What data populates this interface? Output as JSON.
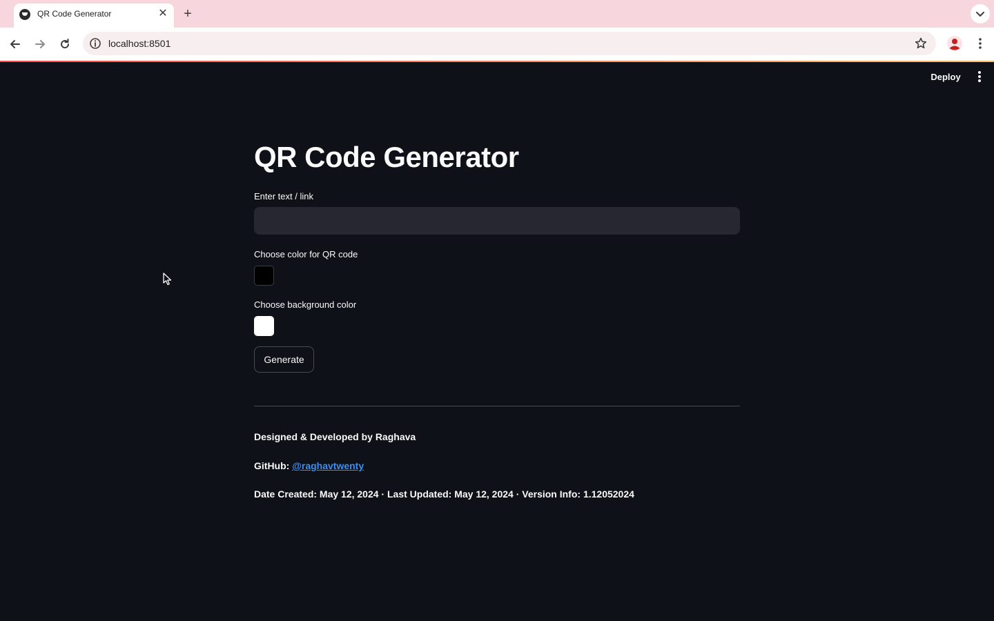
{
  "browser": {
    "tab_title": "QR Code Generator",
    "url": "localhost:8501"
  },
  "header": {
    "deploy_label": "Deploy"
  },
  "main": {
    "title": "QR Code Generator",
    "text_input": {
      "label": "Enter text / link",
      "value": ""
    },
    "qr_color": {
      "label": "Choose color for QR code",
      "value": "#000000"
    },
    "bg_color": {
      "label": "Choose background color",
      "value": "#FFFFFF"
    },
    "generate_label": "Generate"
  },
  "footer": {
    "credit": "Designed & Developed by Raghava",
    "github_prefix": "GitHub: ",
    "github_handle": "@raghavtwenty",
    "meta": "Date Created: May 12, 2024 · Last Updated: May 12, 2024 · Version Info: 1.12052024"
  },
  "colors": {
    "app_background": "#0e1117",
    "text": "#fafafa",
    "input_background": "#262730",
    "link": "#3b8ef3",
    "accent_gradient_start": "#ff4b4b",
    "accent_gradient_end": "#fdbb6a",
    "tab_strip": "#f7d6de"
  }
}
